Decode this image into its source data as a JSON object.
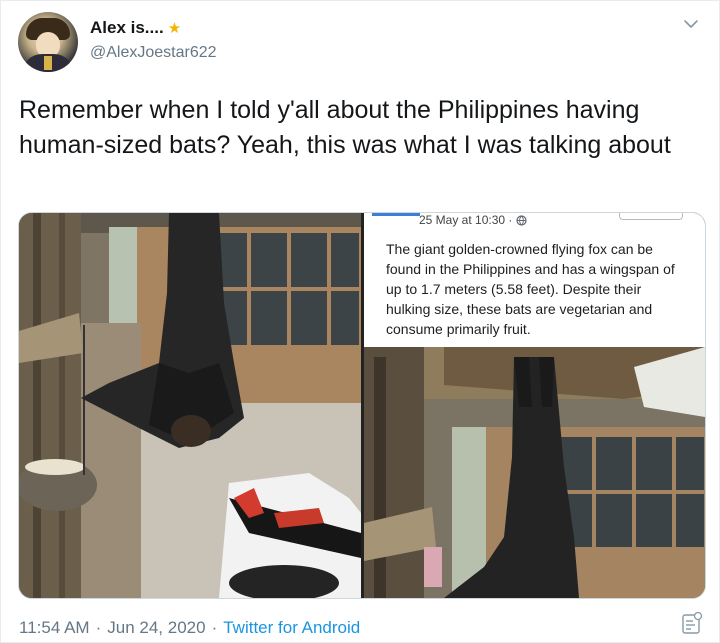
{
  "tweet": {
    "author": {
      "display_name": "Alex is....",
      "name_emoji": "★",
      "handle": "@AlexJoestar622"
    },
    "text": "Remember when I told y'all about the Philippines having human-sized bats? Yeah, this was what I was talking about",
    "media": {
      "right_caption_date": "25 May at 10:30 ·",
      "right_caption_icon": "globe-icon",
      "right_caption_text": "The giant golden-crowned flying fox can be found in the Philippines and has a wingspan of up to 1.7 meters (5.58 feet). Despite their hulking size, these bats are vegetarian and consume primarily fruit."
    },
    "footer": {
      "time": "11:54 AM",
      "separator1": "·",
      "date": "Jun 24, 2020",
      "separator2": "·",
      "source": "Twitter for Android"
    }
  },
  "icons": {
    "menu": "chevron-down-icon",
    "analytics": "analytics-icon"
  },
  "colors": {
    "text": "#14171a",
    "secondary": "#657786",
    "link": "#1b95e0",
    "border": "#e6ecf0"
  }
}
